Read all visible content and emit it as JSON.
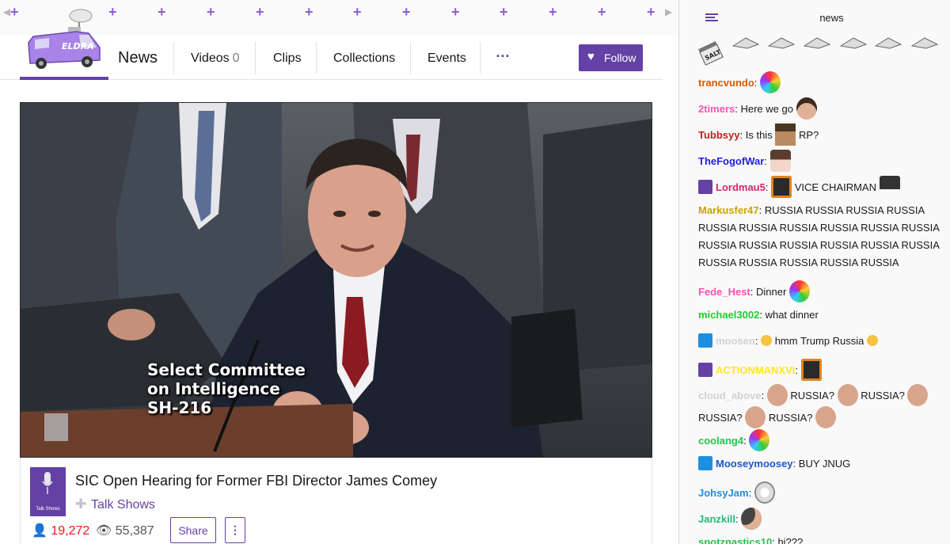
{
  "channel": {
    "name": "News",
    "logo_text": "ELDRA"
  },
  "nav": {
    "tabs": [
      {
        "label": "Videos",
        "count": "0"
      },
      {
        "label": "Clips"
      },
      {
        "label": "Collections"
      },
      {
        "label": "Events"
      }
    ],
    "more_label": "···",
    "follow_label": "Follow"
  },
  "video": {
    "caption_lines": [
      "Select Committee",
      "on Intelligence",
      "SH-216"
    ],
    "title": "SIC Open Hearing for Former FBI Director James Comey",
    "game": "Talk Shows",
    "game_box_label": "Talk Shows",
    "followers": "19,272",
    "views": "55,387",
    "share_label": "Share",
    "more_label": "⋮"
  },
  "chat": {
    "title": "news",
    "salt_label": "SALT",
    "messages": [
      {
        "user": "trancvundo",
        "color": "#d65a00",
        "text": ""
      },
      {
        "user": "2timers",
        "color": "#ff52b1",
        "text": "Here we go"
      },
      {
        "user": "Tubbsyy",
        "color": "#c01f1f",
        "text": "Is this",
        "text2": "RP?"
      },
      {
        "user": "TheFogofWar",
        "color": "#1e1ee0",
        "text": ""
      },
      {
        "user": "Lordmau5",
        "color": "#d2276f",
        "text": "VICE CHAIRMAN"
      },
      {
        "user": "Markusfer47",
        "color": "#c9a600",
        "text": "RUSSIA RUSSIA RUSSIA RUSSIA RUSSIA RUSSIA RUSSIA RUSSIA RUSSIA RUSSIA RUSSIA RUSSIA RUSSIA RUSSIA RUSSIA RUSSIA RUSSIA RUSSIA RUSSIA RUSSIA RUSSIA"
      },
      {
        "user": "Fede_Hest",
        "color": "#ff52b1",
        "text": "Dinner"
      },
      {
        "user": "michael3002",
        "color": "#1ecc2f",
        "text": "what dinner"
      },
      {
        "user": "moosen",
        "color": "#cfd3cf",
        "text": "hmm Trump Russia"
      },
      {
        "user": "ACTIONMANXVI",
        "color": "#ffe61f",
        "text": ""
      },
      {
        "user": "cloud_above",
        "color": "#cfd3cf",
        "text": "RUSSIA?",
        "text2": "RUSSIA?",
        "text3": "RUSSIA?",
        "text4": "RUSSIA?"
      },
      {
        "user": "coolang4",
        "color": "#22c54a",
        "text": ""
      },
      {
        "user": "Mooseymoosey",
        "color": "#1d56cc",
        "text": "BUY JNUG"
      },
      {
        "user": "JohsyJam",
        "color": "#1e8fe0",
        "text": ""
      },
      {
        "user": "Janzkill",
        "color": "#23b87a",
        "text": ""
      },
      {
        "user": "spotznastics10",
        "color": "#22c54a",
        "text": "hi???"
      }
    ]
  },
  "colors": {
    "accent": "#6441a4",
    "follower_red": "#e91916"
  }
}
